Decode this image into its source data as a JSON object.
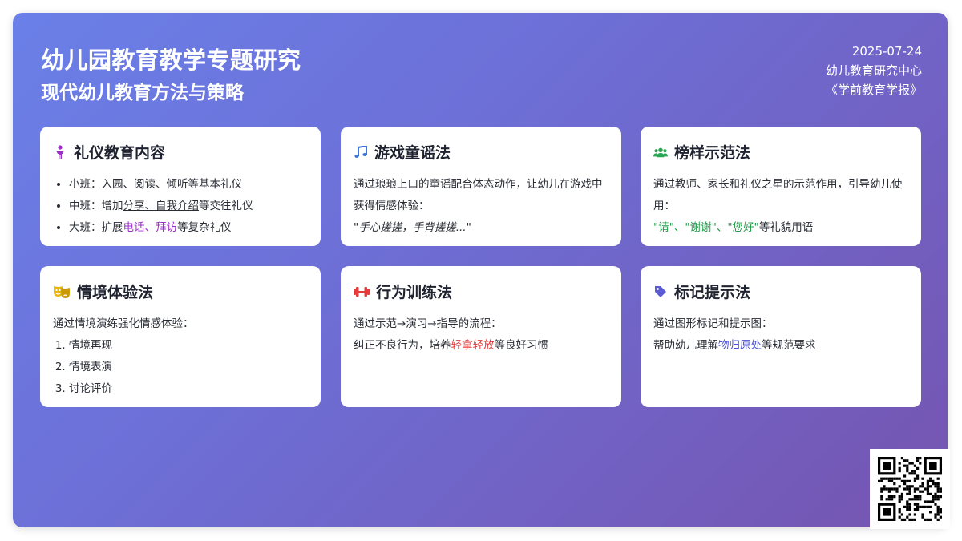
{
  "header": {
    "title": "幼儿园教育教学专题研究",
    "subtitle": "现代幼儿教育方法与策略",
    "date": "2025-07-24",
    "org": "幼儿教育研究中心",
    "journal": "《学前教育学报》"
  },
  "colors": {
    "gradient_start": "#6a80e8",
    "gradient_end": "#7654b0",
    "accent_purple": "#9b2fc8",
    "accent_green": "#1e9a45",
    "accent_red": "#e53b3b",
    "accent_blue": "#4b52d6"
  },
  "cards": {
    "etiquette": {
      "icon": "child-icon",
      "title": "礼仪教育内容",
      "item1": "小班：入园、阅读、倾听等基本礼仪",
      "item2_pre": "中班：增加",
      "item2_hl": "分享、自我介绍",
      "item2_post": "等交往礼仪",
      "item3_pre": "大班：扩展",
      "item3_hl": "电话、拜访",
      "item3_post": "等复杂礼仪"
    },
    "rhyme": {
      "icon": "music-note-icon",
      "title": "游戏童谣法",
      "text": "通过琅琅上口的童谣配合体态动作，让幼儿在游戏中获得情感体验：",
      "quote": "\"手心搓搓，手背搓搓...\""
    },
    "model": {
      "icon": "users-icon",
      "title": "榜样示范法",
      "text": "通过教师、家长和礼仪之星的示范作用，引导幼儿使用：",
      "words": "\"请\"、\"谢谢\"、\"您好\"",
      "words_post": "等礼貌用语"
    },
    "situation": {
      "icon": "theater-masks-icon",
      "title": "情境体验法",
      "text": "通过情境演练强化情感体验：",
      "steps": [
        "情境再现",
        "情境表演",
        "讨论评价"
      ]
    },
    "training": {
      "icon": "dumbbell-icon",
      "title": "行为训练法",
      "text": "通过示范→演习→指导的流程：",
      "line2_pre": "纠正不良行为，培养",
      "line2_hl": "轻拿轻放",
      "line2_post": "等良好习惯"
    },
    "marker": {
      "icon": "tag-icon",
      "title": "标记提示法",
      "text": "通过图形标记和提示图：",
      "line2_pre": "帮助幼儿理解",
      "line2_hl": "物归原处",
      "line2_post": "等规范要求"
    }
  },
  "qr": {
    "icon": "qr-code-icon"
  }
}
